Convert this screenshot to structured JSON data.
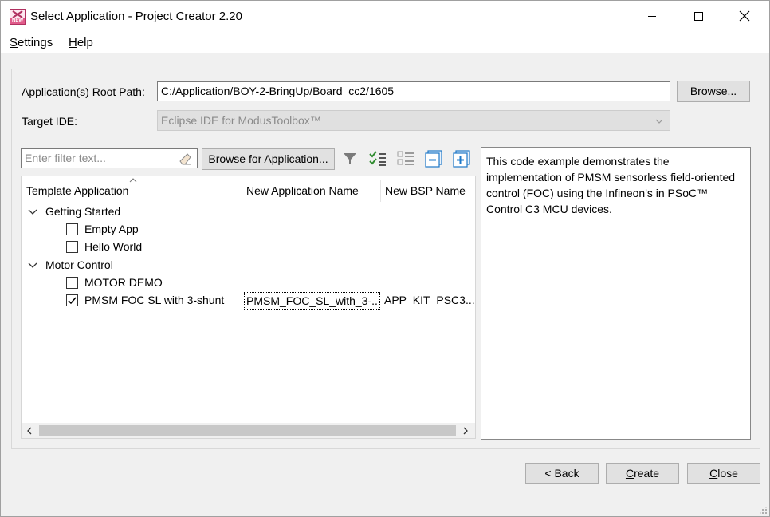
{
  "window": {
    "title": "Select Application - Project Creator 2.20",
    "icon_badge": "NEW",
    "controls": [
      "minimize-icon",
      "maximize-icon",
      "close-icon"
    ]
  },
  "menu": [
    {
      "label": "Settings"
    },
    {
      "label": "Help"
    }
  ],
  "root_path": {
    "label": "Application(s) Root Path:",
    "value": "C:/Application/BOY-2-BringUp/Board_cc2/1605",
    "browse_label": "Browse..."
  },
  "target_ide": {
    "label": "Target IDE:",
    "value": "Eclipse IDE for ModusToolbox™"
  },
  "filter": {
    "placeholder": "Enter filter text...",
    "browse_apps_label": "Browse for Application..."
  },
  "toolbar_icons": [
    "filter-icon",
    "check-all-icon",
    "uncheck-all-icon",
    "collapse-all-icon",
    "expand-all-icon"
  ],
  "tree": {
    "columns": [
      "Template Application",
      "New Application Name",
      "New BSP Name"
    ],
    "groups": [
      {
        "label": "Getting Started",
        "expanded": true,
        "items": [
          {
            "label": "Empty App",
            "checked": false
          },
          {
            "label": "Hello World",
            "checked": false
          }
        ]
      },
      {
        "label": "Motor Control",
        "expanded": true,
        "items": [
          {
            "label": "MOTOR DEMO",
            "checked": false
          },
          {
            "label": "PMSM FOC SL with 3-shunt",
            "checked": true,
            "app_name": "PMSM_FOC_SL_with_3-...",
            "bsp_name": "APP_KIT_PSC3..."
          }
        ]
      }
    ]
  },
  "description": "This code example demonstrates the implementation of PMSM sensorless field-oriented control (FOC) using the Infineon's in PSoC™ Control C3 MCU devices.",
  "buttons": {
    "back": "< Back",
    "create": "Create",
    "close": "Close"
  },
  "colors": {
    "background": "#f0f0f0",
    "button": "#e1e1e1",
    "accent_blue": "#1e78c8"
  }
}
